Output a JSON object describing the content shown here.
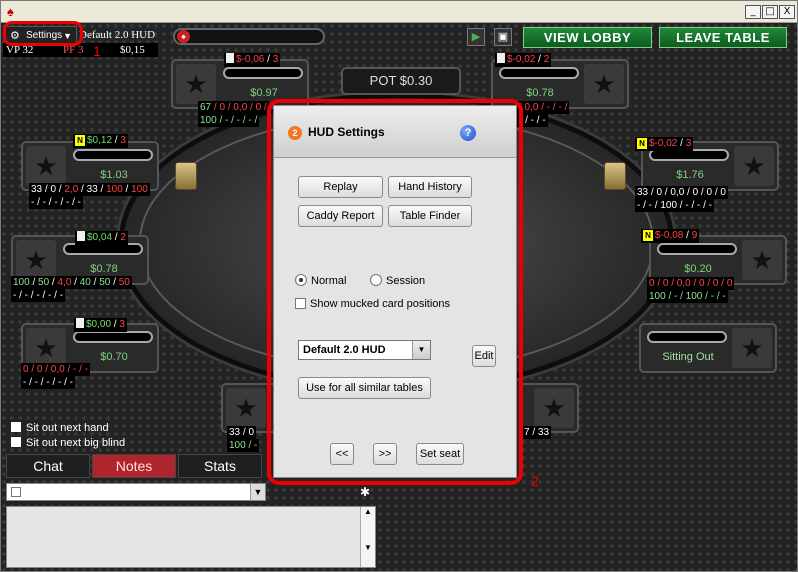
{
  "window": {
    "minimize": "_",
    "maximize": "□",
    "close": "X"
  },
  "topbar": {
    "settings_label": "Settings",
    "hud_name": "Default 2.0 HUD",
    "vp": "VP 32",
    "pf": "PF 3",
    "amount": "$0,15",
    "view_lobby": "VIEW LOBBY",
    "leave_table": "LEAVE TABLE",
    "callout_1": "1"
  },
  "table": {
    "pot": "POT $0.30"
  },
  "seats": {
    "top_left": {
      "hud_top": "$-0,06",
      "hud_top_count": "3",
      "stack": "$0.97",
      "line1_a": "67",
      "line1_b": "/ 0 / 0,0 / 0 /",
      "line2": "100 / - / - / - /"
    },
    "top_right": {
      "hud_top": "$-0,02",
      "hud_top_count": "2",
      "stack": "$0.78",
      "line1": "/ 0,0 / - / - /",
      "line2": "- / - / -"
    },
    "left_upper": {
      "hud_top": "$0,12",
      "hud_top_count": "3",
      "stack": "$1.03",
      "l1_a": "33",
      "l1_b": "0",
      "l1_c": "2,0",
      "l1_d": "33",
      "l1_e": "100",
      "l1_f": "100",
      "line2": "- / - / - / - / -"
    },
    "right_upper": {
      "hud_top": "$-0,02",
      "hud_top_count": "3",
      "stack": "$1.76",
      "line1": "33 / 0 / 0,0 / 0 / 0 / 0",
      "line2": "- / - / 100 / - / - / -"
    },
    "left_mid": {
      "hud_top": "$0,04",
      "hud_top_count": "2",
      "stack": "$0.78",
      "l1_a": "100",
      "l1_b": "50",
      "l1_c": "4,0",
      "l1_d": "40",
      "l1_e": "50",
      "l1_f": "50",
      "line2": "- / - / - / - / -"
    },
    "right_mid": {
      "hud_top": "$-0,08",
      "hud_top_count": "9",
      "stack": "$0.20",
      "line1": "0 / 0 / 0,0 / 0 / 0 / 0",
      "line2": "100 / - / 100 / - / -"
    },
    "left_lower": {
      "hud_top": "$0,00",
      "hud_top_count": "3",
      "stack": "$0.70",
      "line1": "0 / 0 / 0,0 / - / -",
      "line2": "- / - / - / - / -"
    },
    "right_lower": {
      "status": "Sitting Out"
    },
    "bottom_left": {
      "line1": "33 / 0",
      "line2": "100 / -"
    },
    "bottom_right": {
      "line1": "7 / 33"
    }
  },
  "sitout": {
    "next_hand": "Sit out next hand",
    "next_bb": "Sit out next big blind"
  },
  "tabs": {
    "chat": "Chat",
    "notes": "Notes",
    "stats": "Stats"
  },
  "dialog": {
    "badge": "2",
    "title": "HUD Settings",
    "help": "?",
    "replay": "Replay",
    "hand_history": "Hand History",
    "caddy_report": "Caddy Report",
    "table_finder": "Table Finder",
    "normal": "Normal",
    "session": "Session",
    "show_mucked": "Show mucked card positions",
    "hud_select": "Default 2.0 HUD",
    "edit": "Edit",
    "use_all": "Use for all similar tables",
    "prev": "<<",
    "next": ">>",
    "set_seat": "Set seat"
  },
  "callout_2": "2",
  "colors": {
    "accent_red": "#e00000",
    "lobby_green": "#1f8a37",
    "notes_tab": "#b0252c"
  }
}
